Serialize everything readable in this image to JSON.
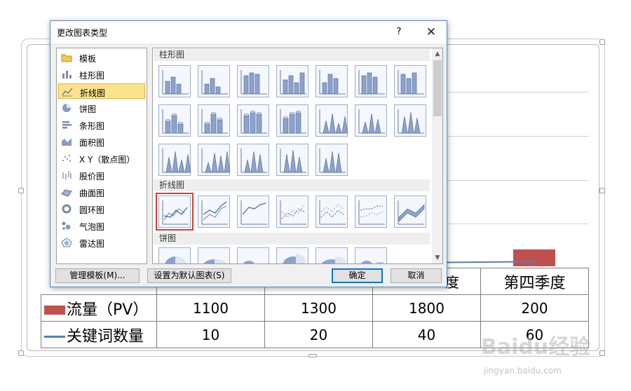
{
  "dialog": {
    "title": "更改图表类型",
    "help": "?",
    "close": "✕",
    "categories": [
      {
        "label": "模板",
        "icon": "folder-icon"
      },
      {
        "label": "柱形图",
        "icon": "column-chart-icon"
      },
      {
        "label": "折线图",
        "icon": "line-chart-icon",
        "selected": true
      },
      {
        "label": "饼图",
        "icon": "pie-chart-icon"
      },
      {
        "label": "条形图",
        "icon": "bar-chart-icon"
      },
      {
        "label": "面积图",
        "icon": "area-chart-icon"
      },
      {
        "label": "X Y（散点图）",
        "icon": "scatter-chart-icon"
      },
      {
        "label": "股价图",
        "icon": "stock-chart-icon"
      },
      {
        "label": "曲面图",
        "icon": "surface-chart-icon"
      },
      {
        "label": "圆环图",
        "icon": "doughnut-chart-icon"
      },
      {
        "label": "气泡图",
        "icon": "bubble-chart-icon"
      },
      {
        "label": "雷达图",
        "icon": "radar-chart-icon"
      }
    ],
    "sections": {
      "column": "柱形图",
      "line": "折线图",
      "pie": "饼图"
    },
    "buttons": {
      "manage_templates": "管理模板(M)...",
      "set_default": "设置为默认图表(S)",
      "ok": "确定",
      "cancel": "取消"
    }
  },
  "background": {
    "table": {
      "header_last": "第四季度",
      "header_partial": "度",
      "rows": [
        {
          "label": "流量（PV）",
          "values": [
            "1100",
            "1300",
            "1800",
            "200"
          ]
        },
        {
          "label": "关键词数量",
          "values": [
            "10",
            "20",
            "40",
            "60"
          ]
        }
      ]
    },
    "colors": {
      "series_traffic": "#c0504d",
      "series_keywords": "#4f81bd",
      "dialog_border": "#5b8ac5",
      "selection_outline": "#e03a2a"
    }
  },
  "watermark": {
    "brand": "Baidu经验",
    "url": "jingyan.baidu.com"
  }
}
